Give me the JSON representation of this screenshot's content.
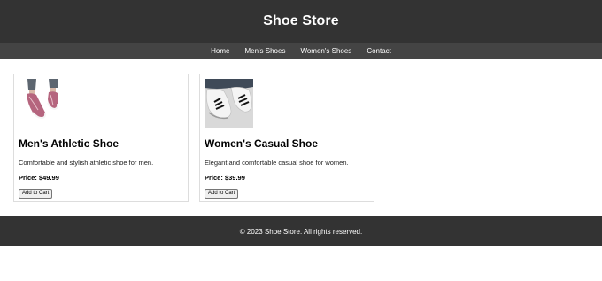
{
  "header": {
    "title": "Shoe Store"
  },
  "nav": {
    "items": [
      {
        "label": "Home",
        "icon": "none"
      },
      {
        "label": "Men's Shoes",
        "icon": "none"
      },
      {
        "label": "Women's Shoes",
        "icon": "none"
      },
      {
        "label": "Contact",
        "icon": "none"
      }
    ]
  },
  "products": [
    {
      "name": "Men's Athletic Shoe",
      "description": "Comfortable and stylish athletic shoe for men.",
      "price": "Price: $49.99",
      "button_label": "Add to Cart",
      "image_icon": "pink-knit-sneaker-photo",
      "image_accent": "#b5657e"
    },
    {
      "name": "Women's Casual Shoe",
      "description": "Elegant and comfortable casual shoe for women.",
      "price": "Price: $39.99",
      "button_label": "Add to Cart",
      "image_icon": "white-black-stripe-sneaker-photo",
      "image_accent": "#f2f2f2"
    }
  ],
  "footer": {
    "text": "© 2023 Shoe Store. All rights reserved."
  },
  "colors": {
    "header_bg": "#333333",
    "nav_bg": "#444444",
    "footer_bg": "#333333",
    "card_border": "#dddddd"
  }
}
